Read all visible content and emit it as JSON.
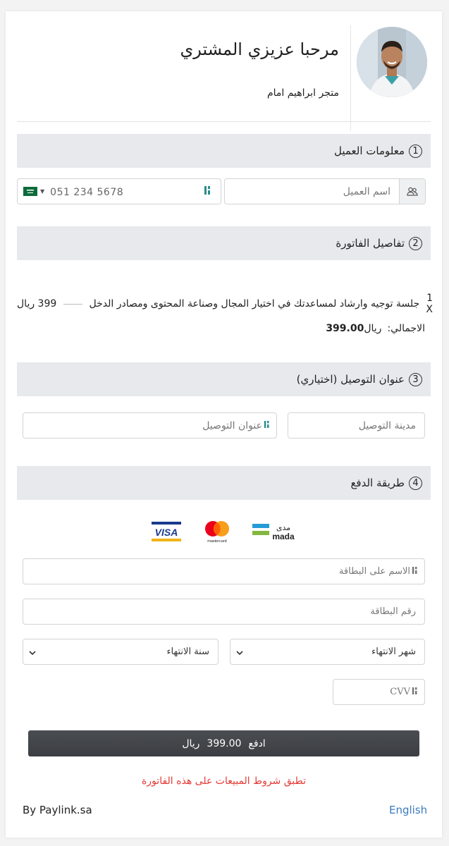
{
  "header": {
    "greeting": "مرحبا عزيزي المشتري",
    "store_name": "متجر ابراهيم امام"
  },
  "sections": {
    "s1": {
      "number": "1",
      "title": "معلومات العميل"
    },
    "s2": {
      "number": "2",
      "title": "تفاصيل الفاتورة"
    },
    "s3": {
      "number": "3",
      "title": "عنوان التوصيل (اختياري)"
    },
    "s4": {
      "number": "4",
      "title": "طريقة الدفع"
    }
  },
  "customer": {
    "name_placeholder": "اسم العميل",
    "phone_placeholder": "051 234 5678"
  },
  "invoice": {
    "item_qty": "1 X",
    "item_name": "جلسة توجيه وارشاد لمساعدتك في اختيار المجال وصناعة المحتوى ومصادر الدخل",
    "item_price": "399 ريال",
    "total_label": "الاجمالي:",
    "total_amount": "399.00",
    "total_currency": "ريال"
  },
  "delivery": {
    "city_placeholder": "مدينة التوصيل",
    "address_placeholder": "عنوان التوصيل"
  },
  "payment": {
    "brands": [
      "VISA",
      "mastercard",
      "mada"
    ],
    "card_name_placeholder": "الاسم على البطاقة",
    "card_number_placeholder": "رقم البطاقة",
    "expiry_month_placeholder": "شهر الانتهاء",
    "expiry_year_placeholder": "سنة الانتهاء",
    "cvv_placeholder": "CVV",
    "pay_button_prefix": "ادفع",
    "pay_button_amount": "399.00",
    "pay_button_currency": "ريال"
  },
  "footer": {
    "terms": "تطبق شروط المبيعات على هذه الفاتورة",
    "by": "By Paylink.sa",
    "language": "English"
  },
  "colors": {
    "section_bg": "#e8e9ec",
    "pay_button": "#3f4246",
    "terms_text": "#e53935",
    "link": "#3b7bbf"
  }
}
